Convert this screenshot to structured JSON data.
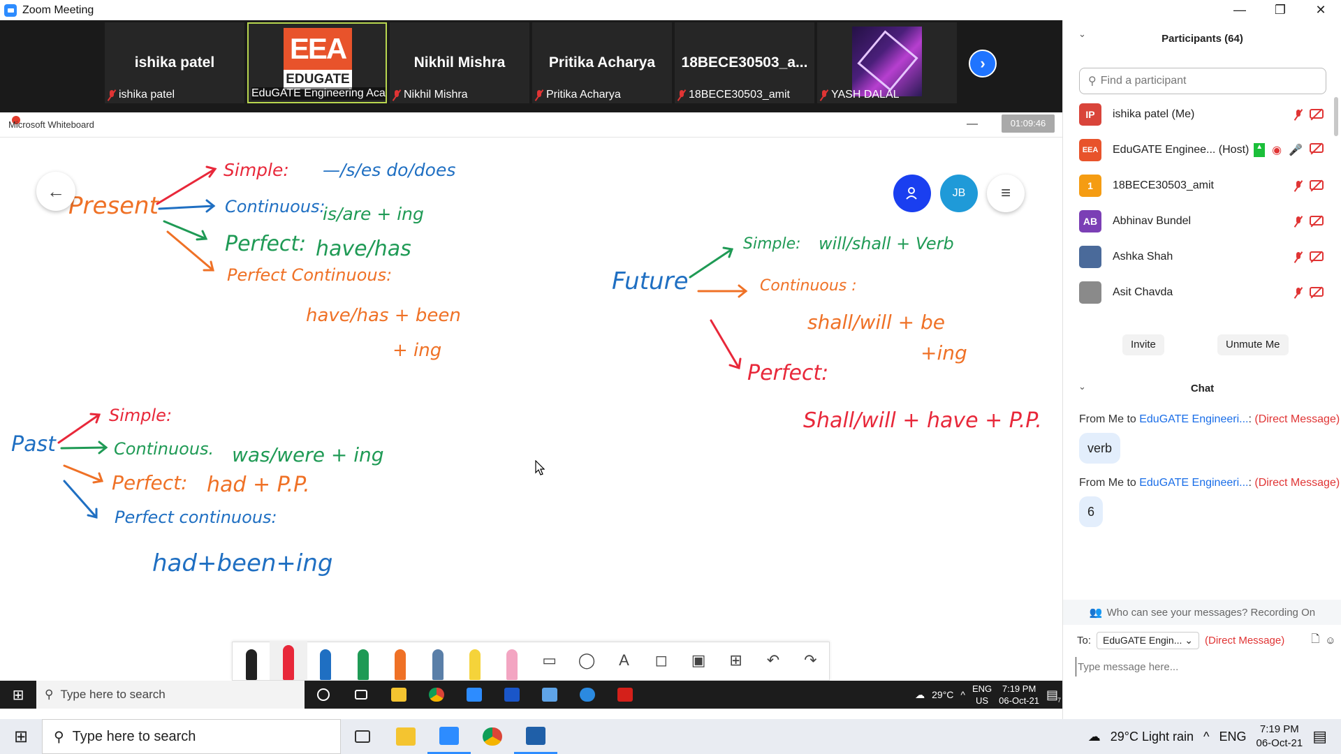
{
  "window": {
    "title": "Zoom Meeting",
    "minimize": "—",
    "restore": "❐",
    "close": "✕"
  },
  "strip": {
    "tiles": [
      {
        "big": "ishika patel",
        "caption": "ishika patel"
      },
      {
        "big": "",
        "caption": "EduGATE Engineering Aca...",
        "logo_top": "EEA",
        "logo_bottom": "EDUGATE"
      },
      {
        "big": "Nikhil Mishra",
        "caption": "Nikhil Mishra"
      },
      {
        "big": "Pritika Acharya",
        "caption": "Pritika Acharya"
      },
      {
        "big": "18BECE30503_a...",
        "caption": "18BECE30503_amit"
      },
      {
        "big": "",
        "caption": "YASH DALAL"
      }
    ],
    "next": "›"
  },
  "whiteboard": {
    "app_title": "Microsoft Whiteboard",
    "timer": "01:09:46",
    "minimize": "—",
    "back": "←",
    "avatar_initials": "JB",
    "menu": "≡",
    "notes": {
      "present": "Present",
      "p_simple": "Simple:",
      "p_simple_rule": "—/s/es   do/does",
      "p_cont": "Continuous:",
      "p_cont_rule": "is/are + ing",
      "p_perf": "Perfect:",
      "p_perf_rule": "have/has",
      "p_perfcont": "Perfect Continuous:",
      "p_perfcont_rule1": "have/has + been",
      "p_perfcont_rule2": "+ ing",
      "future": "Future",
      "f_simple": "Simple:",
      "f_simple_rule": "will/shall + Verb",
      "f_cont": "Continuous :",
      "f_cont_rule1": "shall/will + be",
      "f_cont_rule2": "+ing",
      "f_perf": "Perfect:",
      "f_perf_rule": "Shall/will + have + P.P.",
      "past": "Past",
      "pa_simple": "Simple:",
      "pa_cont": "Continuous.",
      "pa_cont_rule": "was/were + ing",
      "pa_perf": "Perfect:",
      "pa_perf_rule": "had + P.P.",
      "pa_perfcont": "Perfect continuous:",
      "pa_perfcont_rule": "had+been+ing"
    }
  },
  "taskbar_inner": {
    "search_placeholder": "Type here to search",
    "weather": "29°C",
    "lang1": "ENG",
    "lang2": "US",
    "time": "7:19 PM",
    "date": "06-Oct-21",
    "notif_count": "7"
  },
  "taskbar_outer": {
    "search_placeholder": "Type here to search",
    "weather": "29°C  Light rain",
    "lang": "ENG",
    "time": "7:19 PM",
    "date": "06-Oct-21"
  },
  "panel": {
    "participants_title": "Participants (64)",
    "find_placeholder": "Find a participant",
    "participants": [
      {
        "initials": "IP",
        "color": "#d9443a",
        "name": "ishika patel (Me)"
      },
      {
        "initials": "EEA",
        "color": "#e8532b",
        "name": "EduGATE Enginee...  (Host)"
      },
      {
        "initials": "1",
        "color": "#f59c12",
        "name": "18BECE30503_amit"
      },
      {
        "initials": "AB",
        "color": "#7b3fb5",
        "name": "Abhinav Bundel"
      },
      {
        "initials": "",
        "color": "#4a6a9a",
        "name": "Ashka Shah"
      },
      {
        "initials": "",
        "color": "#8a8a8a",
        "name": "Asit Chavda"
      }
    ],
    "invite": "Invite",
    "unmute": "Unmute Me",
    "chat_title": "Chat",
    "messages": [
      {
        "from": "From Me to ",
        "to": "EduGATE Engineeri...",
        "sep": ": ",
        "dm": "(Direct Message)",
        "text": "verb"
      },
      {
        "from": "From Me to ",
        "to": "EduGATE Engineeri...",
        "sep": ": ",
        "dm": "(Direct Message)",
        "text": "6"
      }
    ],
    "who_can_see": "Who can see your messages? Recording On",
    "to_label": "To:",
    "to_value": "EduGATE Engin...",
    "to_dm": "(Direct Message)",
    "message_placeholder": "Type message here..."
  }
}
